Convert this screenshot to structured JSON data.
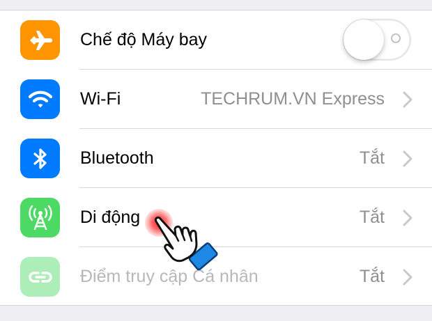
{
  "settings": {
    "airplane": {
      "label": "Chế độ Máy bay",
      "icon": "airplane-icon",
      "icon_color": "#ff9500",
      "toggle_on": false
    },
    "wifi": {
      "label": "Wi-Fi",
      "value": "TECHRUM.VN Express",
      "icon": "wifi-icon",
      "icon_color": "#007aff"
    },
    "bluetooth": {
      "label": "Bluetooth",
      "value": "Tắt",
      "icon": "bluetooth-icon",
      "icon_color": "#007aff"
    },
    "cellular": {
      "label": "Di động",
      "value": "Tắt",
      "icon": "cellular-antenna-icon",
      "icon_color": "#4cd964"
    },
    "hotspot": {
      "label": "Điểm truy cập Cá nhân",
      "value": "Tắt",
      "icon": "hotspot-link-icon",
      "icon_color": "#4cd964",
      "disabled": true
    }
  },
  "overlay": {
    "pointer": "hand-pointer-icon",
    "tap_indicator_color": "#ff1e1e"
  }
}
